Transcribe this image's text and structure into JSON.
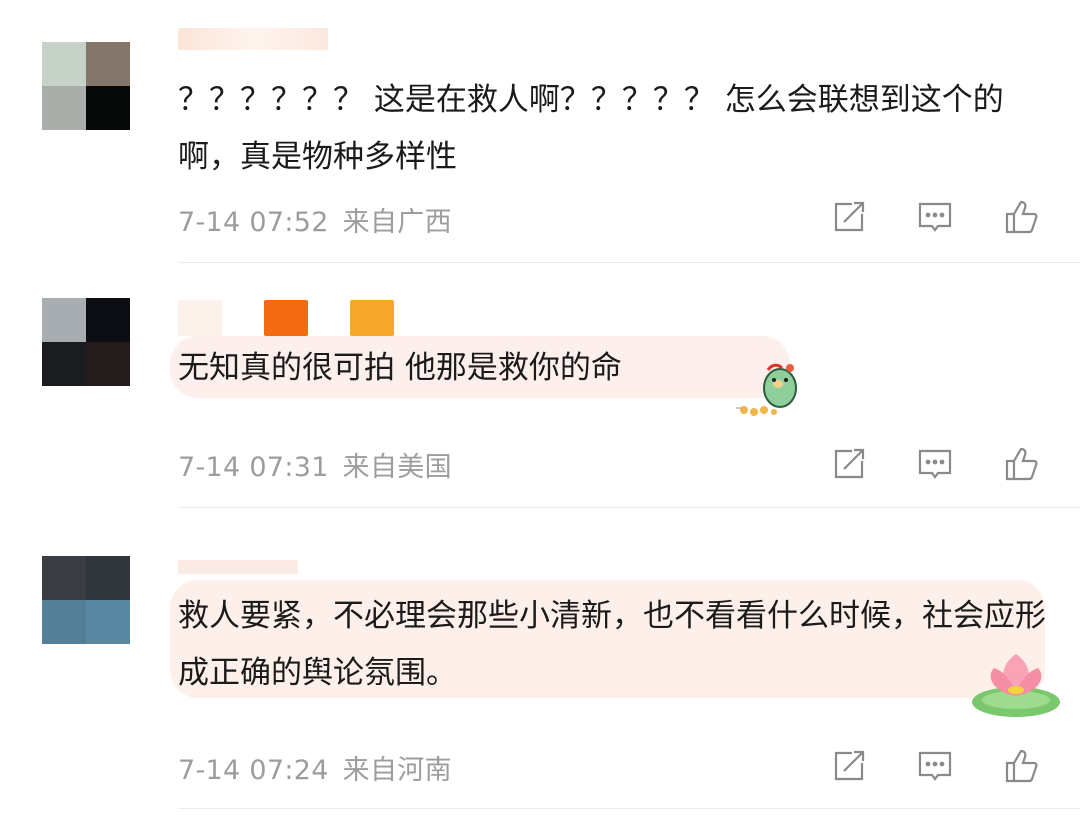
{
  "comments": [
    {
      "avatar_colors": [
        "#c6d1c7",
        "#84766a",
        "#a9aeaa",
        "#070808"
      ],
      "name_colors": [],
      "text": "？？？？？？ 这是在救人啊？？？？？ 怎么会联想到这个的啊，真是物种多样性",
      "time": "7-14 07:52",
      "location": "来自广西"
    },
    {
      "avatar_colors": [
        "#a8adb1",
        "#0b0d12",
        "#1a1c20",
        "#241c1c"
      ],
      "name_colors": [
        "#fdf1ec",
        "#f26b10",
        "#f7a72c"
      ],
      "text": "无知真的很可拍 他那是救你的命",
      "time": "7-14 07:31",
      "location": "来自美国",
      "bubble_color": "#fdf0ec",
      "sticker": "gourd-character-sticker"
    },
    {
      "avatar_colors": [
        "#3a3e42",
        "#30363b",
        "#557f96",
        "#5a87a1"
      ],
      "name_colors": [],
      "text": "救人要紧，不必理会那些小清新，也不看看什么时候，社会应形成正确的舆论氛围。",
      "time": "7-14 07:24",
      "location": "来自河南",
      "bubble_color": "#fdefea",
      "sticker": "lotus-sticker"
    }
  ],
  "icons": {
    "share": "share-icon",
    "comment": "comment-icon",
    "like": "like-icon"
  }
}
